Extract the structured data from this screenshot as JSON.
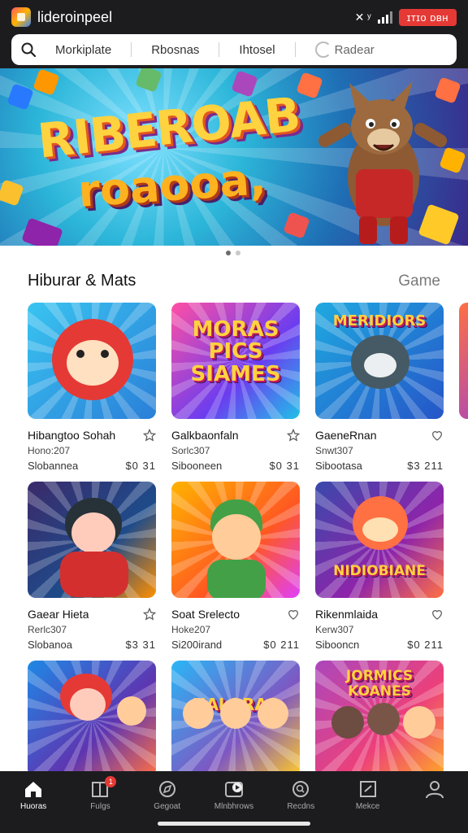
{
  "status_bar": {
    "app_name": "lideroinpeel",
    "time": "ɪᴛɪᴏ ᴅʙʜ",
    "status_glyphs": "✕ ʸ",
    "accent_color": "#e53935"
  },
  "search": {
    "icon": "search-icon",
    "chips": [
      "Morkiplate",
      "Rbosnas",
      "Ihtosel"
    ],
    "radar_label": "Radear"
  },
  "hero": {
    "title": "RIBEROAB",
    "subtitle": "roaooa,",
    "carousel": {
      "count": 2,
      "active": 0
    }
  },
  "section": {
    "title": "Hiburar & Mats",
    "link": "Game"
  },
  "games": [
    {
      "title": "Hibangtoo Sohah",
      "meta": "Hono:207",
      "tag": "Slobannea",
      "price": "$0 31",
      "fav_icon": "star-icon",
      "thumb_text": ""
    },
    {
      "title": "Galkbaonfaln",
      "meta": "Sorlc307",
      "tag": "Sibooneen",
      "price": "$0 31",
      "fav_icon": "star-icon",
      "thumb_text": "MORAS PICS SIAMES"
    },
    {
      "title": "GaeneRnan",
      "meta": "Snwt307",
      "tag": "Sibootasa",
      "price": "$3 211",
      "fav_icon": "heart-icon",
      "thumb_text": "MERIDIORS"
    },
    {
      "title": "Gaear Hieta",
      "meta": "Rerlc307",
      "tag": "Slobanoa",
      "price": "$3 31",
      "fav_icon": "star-icon",
      "thumb_text": ""
    },
    {
      "title": "Soat Srelecto",
      "meta": "Hoke207",
      "tag": "Si200irand",
      "price": "$0 211",
      "fav_icon": "heart-icon",
      "thumb_text": ""
    },
    {
      "title": "Rikenmlaida",
      "meta": "Kerw307",
      "tag": "Sibooncn",
      "price": "$0 211",
      "fav_icon": "heart-icon",
      "thumb_text": "NIDIOBIANE"
    },
    {
      "title": "",
      "meta": "",
      "tag": "",
      "price": "",
      "fav_icon": "",
      "thumb_text": ""
    },
    {
      "title": "",
      "meta": "",
      "tag": "",
      "price": "",
      "fav_icon": "",
      "thumb_text": "NALORAS CELEINS"
    },
    {
      "title": "",
      "meta": "",
      "tag": "",
      "price": "",
      "fav_icon": "",
      "thumb_text": "JORMICS KOANES"
    }
  ],
  "bottom_nav": [
    {
      "label": "Huoras",
      "icon": "home-icon",
      "active": true,
      "badge": ""
    },
    {
      "label": "Fulgs",
      "icon": "grid-icon",
      "active": false,
      "badge": "1"
    },
    {
      "label": "Gegoat",
      "icon": "compass-icon",
      "active": false,
      "badge": ""
    },
    {
      "label": "Mlnbhrows",
      "icon": "play-icon",
      "active": false,
      "badge": ""
    },
    {
      "label": "Recdns",
      "icon": "search-icon",
      "active": false,
      "badge": ""
    },
    {
      "label": "Mekce",
      "icon": "edit-icon",
      "active": false,
      "badge": ""
    },
    {
      "label": "",
      "icon": "profile-icon",
      "active": false,
      "badge": ""
    }
  ]
}
